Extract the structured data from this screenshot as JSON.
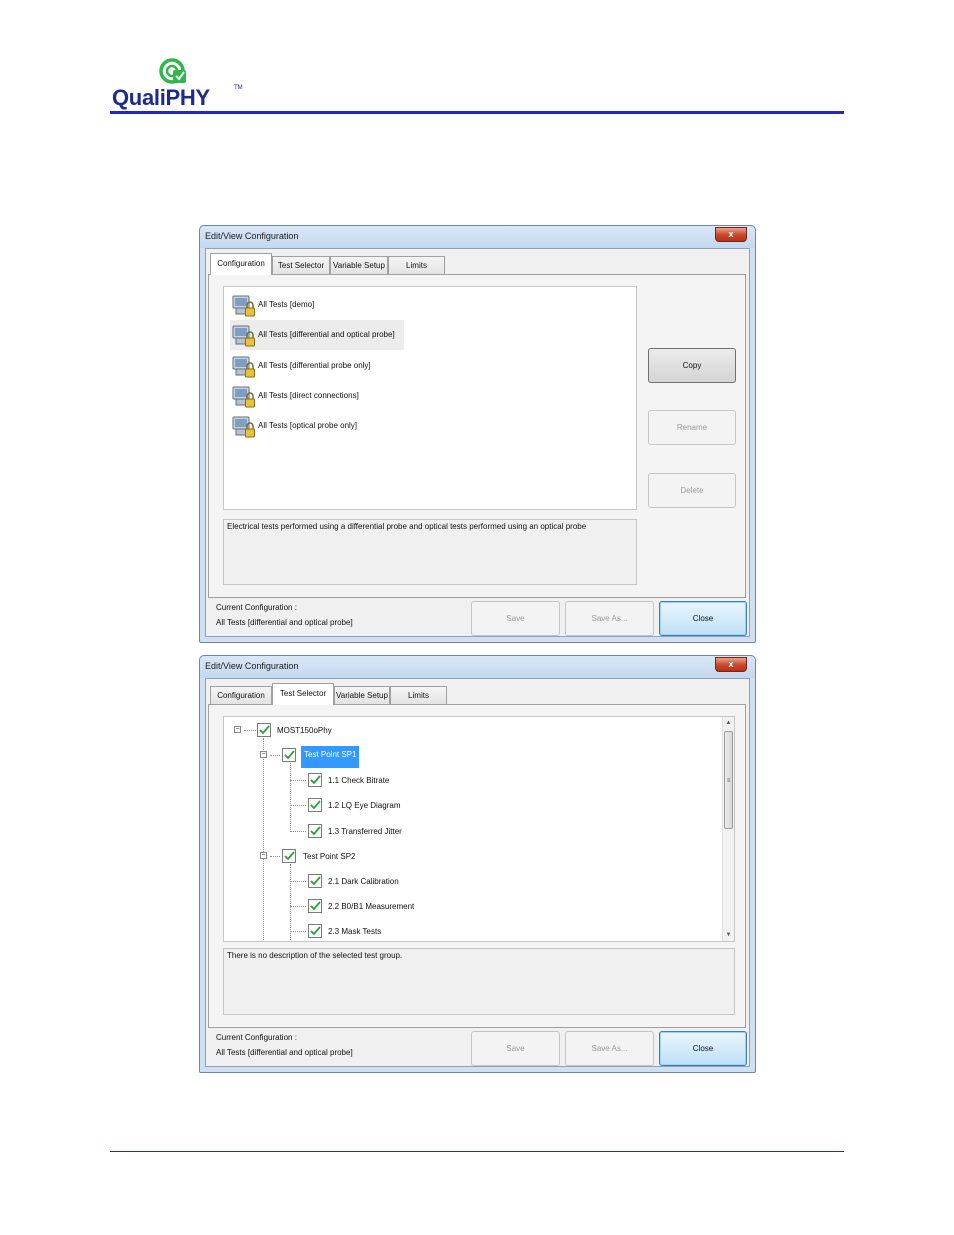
{
  "header": {
    "logo_text": "QualiPHY",
    "logo_tm": "TM"
  },
  "colors": {
    "brand_blue": "#1d2bb8",
    "selection_blue": "#3399ff",
    "window_frame": "#cfe0f2",
    "close_red": "#c9452a"
  },
  "dialog1": {
    "title": "Edit/View Configuration",
    "close_glyph": "x",
    "tabs": [
      "Configuration",
      "Test Selector",
      "Variable Setup",
      "Limits"
    ],
    "active_tab": "Configuration",
    "configurations": [
      {
        "label": "All Tests [demo]",
        "icon": "locked-config-icon"
      },
      {
        "label": "All Tests [differential and optical probe]",
        "icon": "locked-config-icon",
        "selected": true
      },
      {
        "label": "All Tests [differential probe only]",
        "icon": "locked-config-icon"
      },
      {
        "label": "All Tests [direct connections]",
        "icon": "locked-config-icon"
      },
      {
        "label": "All Tests [optical probe only]",
        "icon": "locked-config-icon"
      }
    ],
    "description": "Electrical tests performed using a differential probe and optical tests performed using an optical probe",
    "buttons": {
      "copy": "Copy",
      "rename": "Rename",
      "delete": "Delete",
      "save": "Save",
      "save_as": "Save As...",
      "close": "Close"
    },
    "current_config_label": "Current Configuration :",
    "current_config_value": "All Tests [differential and optical probe]"
  },
  "dialog2": {
    "title": "Edit/View Configuration",
    "close_glyph": "x",
    "tabs": [
      "Configuration",
      "Test Selector",
      "Variable Setup",
      "Limits"
    ],
    "active_tab": "Test Selector",
    "tree": {
      "root": "MOST150oPhy",
      "groups": [
        {
          "label": "Test Point SP1",
          "selected": true,
          "children": [
            "1.1 Check Bitrate",
            "1.2 LQ Eye Diagram",
            "1.3 Transferred Jitter"
          ]
        },
        {
          "label": "Test Point SP2",
          "children": [
            "2.1 Dark Calibration",
            "2.2 B0/B1 Measurement",
            "2.3 Mask Tests"
          ]
        }
      ]
    },
    "scroll_up": "▲",
    "scroll_down": "▼",
    "scroll_grip": "≡",
    "expander_glyph": "−",
    "description": "There is no description of the selected test group.",
    "buttons": {
      "save": "Save",
      "save_as": "Save As...",
      "close": "Close"
    },
    "current_config_label": "Current Configuration :",
    "current_config_value": "All Tests [differential and optical probe]"
  }
}
